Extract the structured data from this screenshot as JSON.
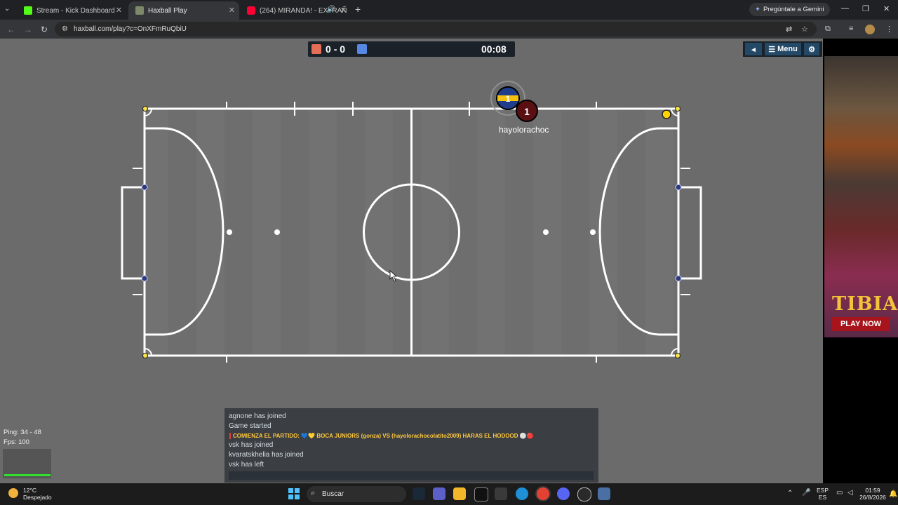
{
  "browser": {
    "tabs": [
      {
        "label": "Stream - Kick Dashboard",
        "favicon_color": "#53fc18"
      },
      {
        "label": "Haxball Play",
        "favicon_color": "#7c8a6a"
      },
      {
        "label": "(264) MIRANDA! - EXTRAÑ",
        "favicon_color": "#ff0033"
      }
    ],
    "new_tab": "+",
    "gemini_button": "Pregúntale a Gemini",
    "url": "haxball.com/play?c=OnXFmRuQbiU"
  },
  "game": {
    "red_score": "0",
    "separator": "-",
    "blue_score": "0",
    "timer": "00:08",
    "menu_label": "Menu",
    "red_team_color": "#e56e56",
    "blue_team_color": "#5689e5",
    "player_name": "hayolorachoc",
    "player_number": "1",
    "opponent_number": "1"
  },
  "ad": {
    "brand": "TIBIA",
    "cta": "PLAY NOW"
  },
  "stats": {
    "ping": "Ping: 34 - 48",
    "fps": "Fps: 100"
  },
  "chat": {
    "lines": [
      "agnone has joined",
      "Game started",
      "COMIENZA EL PARTIDO: 💙💛 BOCA JUNIORS (gonza) VS (hayolorachocolatito2009) HARAS EL HODOOD ⚪🔴",
      "vsk has joined",
      "kvaratskhelia has joined",
      "vsk has left"
    ]
  },
  "taskbar": {
    "temperature": "12°C",
    "weather": "Despejado",
    "search_placeholder": "Buscar",
    "lang_top": "ESP",
    "lang_bottom": "ES",
    "time": "01:59",
    "date": "26/8/2026"
  }
}
